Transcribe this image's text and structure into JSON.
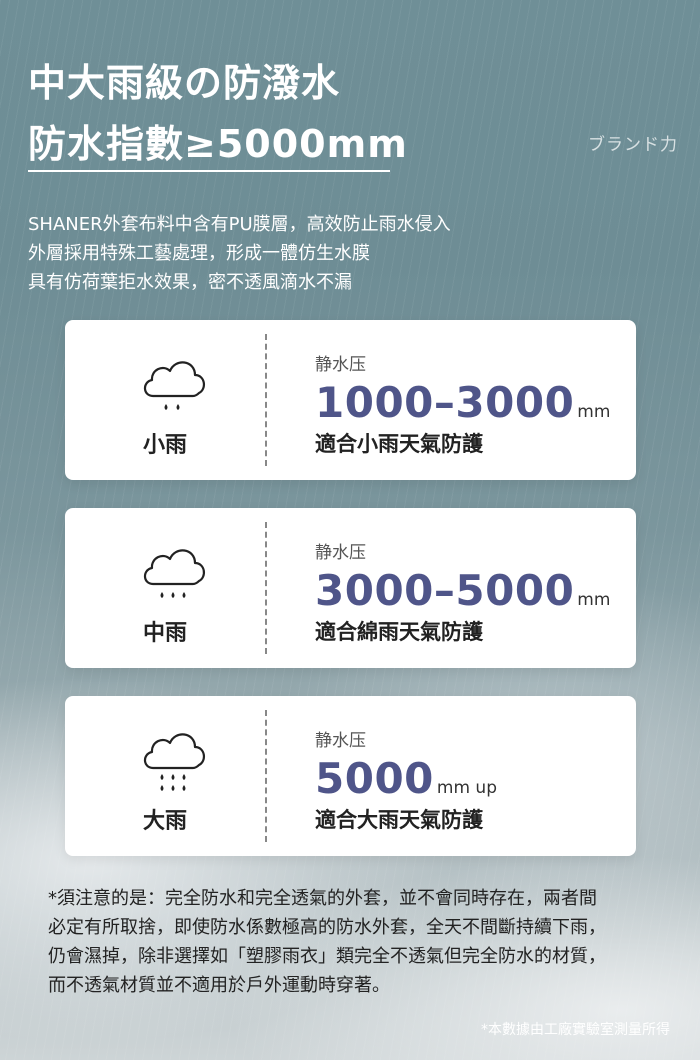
{
  "header": {
    "title_line1": "中大雨級の防潑水",
    "title_line2": "防水指數≥5000mm",
    "brand": "ブランド力"
  },
  "intro": [
    "SHANER外套布料中含有PU膜層，高效防止雨水侵入",
    "外層採用特殊工藝處理，形成一體仿生水膜",
    "具有仿荷葉拒水效果，密不透風滴水不漏"
  ],
  "cards": [
    {
      "icon": "cloud-light-rain-icon",
      "rain_label": "小雨",
      "pressure_label": "静水压",
      "value": "1000–3000",
      "unit": "mm",
      "desc": "適合小雨天氣防護"
    },
    {
      "icon": "cloud-moderate-rain-icon",
      "rain_label": "中雨",
      "pressure_label": "静水压",
      "value": "3000–5000",
      "unit": "mm",
      "desc": "適合綿雨天氣防護"
    },
    {
      "icon": "cloud-heavy-rain-icon",
      "rain_label": "大雨",
      "pressure_label": "静水压",
      "value": "5000",
      "unit": "mm up",
      "desc": "適合大雨天氣防護"
    }
  ],
  "note": [
    "*須注意的是：完全防水和完全透氣的外套，並不會同時存在，兩者間",
    "必定有所取捨，即使防水係數極高的防水外套，全天不間斷持續下雨，",
    "仍會濕掉，除非選擇如「塑膠雨衣」類完全不透氣但完全防水的材質，",
    "而不透氣材質並不適用於戶外運動時穿著。"
  ],
  "source": "*本數據由工廠實驗室測量所得",
  "colors": {
    "value_accent": "#4f5589",
    "card_bg": "#ffffff"
  }
}
